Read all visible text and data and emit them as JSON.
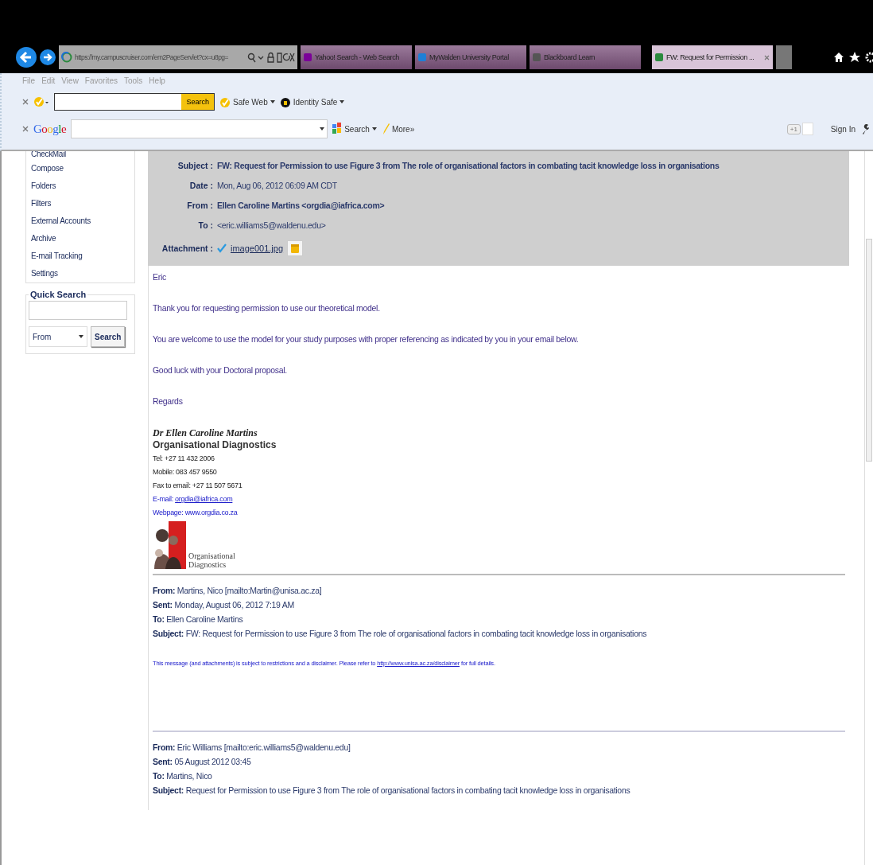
{
  "browser": {
    "address": "https://my.campuscruiser.com/em2PageServlet?cx=u8pg=",
    "tabs": [
      {
        "label": "Yahoo! Search - Web Search",
        "kind": "yahoo",
        "selected": false
      },
      {
        "label": "MyWalden University Portal",
        "kind": "ie",
        "selected": false
      },
      {
        "label": "Blackboard Learn",
        "kind": "bb",
        "selected": false
      },
      {
        "label": "FW: Request for Permission ...",
        "kind": "cc",
        "selected": true
      }
    ],
    "menu": [
      "File",
      "Edit",
      "View",
      "Favorites",
      "Tools",
      "Help"
    ],
    "norton": {
      "search_button": "Search",
      "items": [
        "Safe Web",
        "Identity Safe"
      ]
    },
    "google": {
      "logo": "Google",
      "search": "Search",
      "more": "More»",
      "plus_one": "+1",
      "sign_in": "Sign In"
    }
  },
  "sidebar": {
    "items": [
      "CheckMail",
      "Compose",
      "Folders",
      "Filters",
      "External Accounts",
      "Archive",
      "E-mail Tracking",
      "Settings"
    ],
    "quick_search": {
      "title": "Quick Search",
      "field_option": "From",
      "button": "Search"
    }
  },
  "email": {
    "header": [
      {
        "label": "Subject :",
        "value": "FW: Request for Permission to use Figure 3 from The role of organisational factors in combating tacit knowledge loss in organisations",
        "bold": true
      },
      {
        "label": "Date :",
        "value": "Mon, Aug 06, 2012 06:09 AM CDT",
        "bold": false
      },
      {
        "label": "From :",
        "value": "Ellen Caroline Martins <orgdia@iafrica.com>",
        "bold": true
      },
      {
        "label": "To :",
        "value": "<eric.williams5@waldenu.edu>",
        "bold": false
      }
    ],
    "attachment": {
      "label": "Attachment :",
      "file": "image001.jpg"
    },
    "body": [
      "Eric",
      "Thank you for requesting permission to use our theoretical model.",
      "You are welcome to use the model for your study purposes with proper referencing as indicated by you in your email below.",
      "Good luck with your Doctoral proposal.",
      "Regards"
    ],
    "signature": {
      "name": "Dr Ellen Caroline Martins",
      "org": "Organisational Diagnostics",
      "lines": [
        "Tel: +27 11 432 2006",
        "Mobile: 083 457 9550",
        "Fax to email: +27 11 507 5671"
      ],
      "email_label": "E-mail:",
      "email": "orgdia@iafrica.com",
      "webpage": "Webpage: www.orgdia.co.za",
      "logo_text": [
        "Organisational",
        "Diagnostics"
      ]
    },
    "forwards": [
      {
        "fields": [
          {
            "label": "From:",
            "value": "Martins, Nico [mailto:Martin@unisa.ac.za]"
          },
          {
            "label": "Sent:",
            "value": "Monday, August 06, 2012 7:19 AM"
          },
          {
            "label": "To:",
            "value": "Ellen Caroline Martins"
          },
          {
            "label": "Subject:",
            "value": "FW: Request for Permission to use Figure 3 from The role of organisational factors in combating tacit knowledge loss in organisations"
          }
        ],
        "disclaimer": {
          "before": "This message (and attachments) is subject to restrictions and a disclaimer. Please refer to",
          "link": "http://www.unisa.ac.za/disclaimer",
          "after": "for full details."
        }
      },
      {
        "fields": [
          {
            "label": "From:",
            "value": "Eric Williams [mailto:eric.williams5@waldenu.edu]"
          },
          {
            "label": "Sent:",
            "value": "05 August 2012 03:45"
          },
          {
            "label": "To:",
            "value": "Martins, Nico"
          },
          {
            "label": "Subject:",
            "value": "Request for Permission to use Figure 3 from The role of organisational factors in combating tacit knowledge loss in organisations"
          }
        ]
      }
    ]
  }
}
